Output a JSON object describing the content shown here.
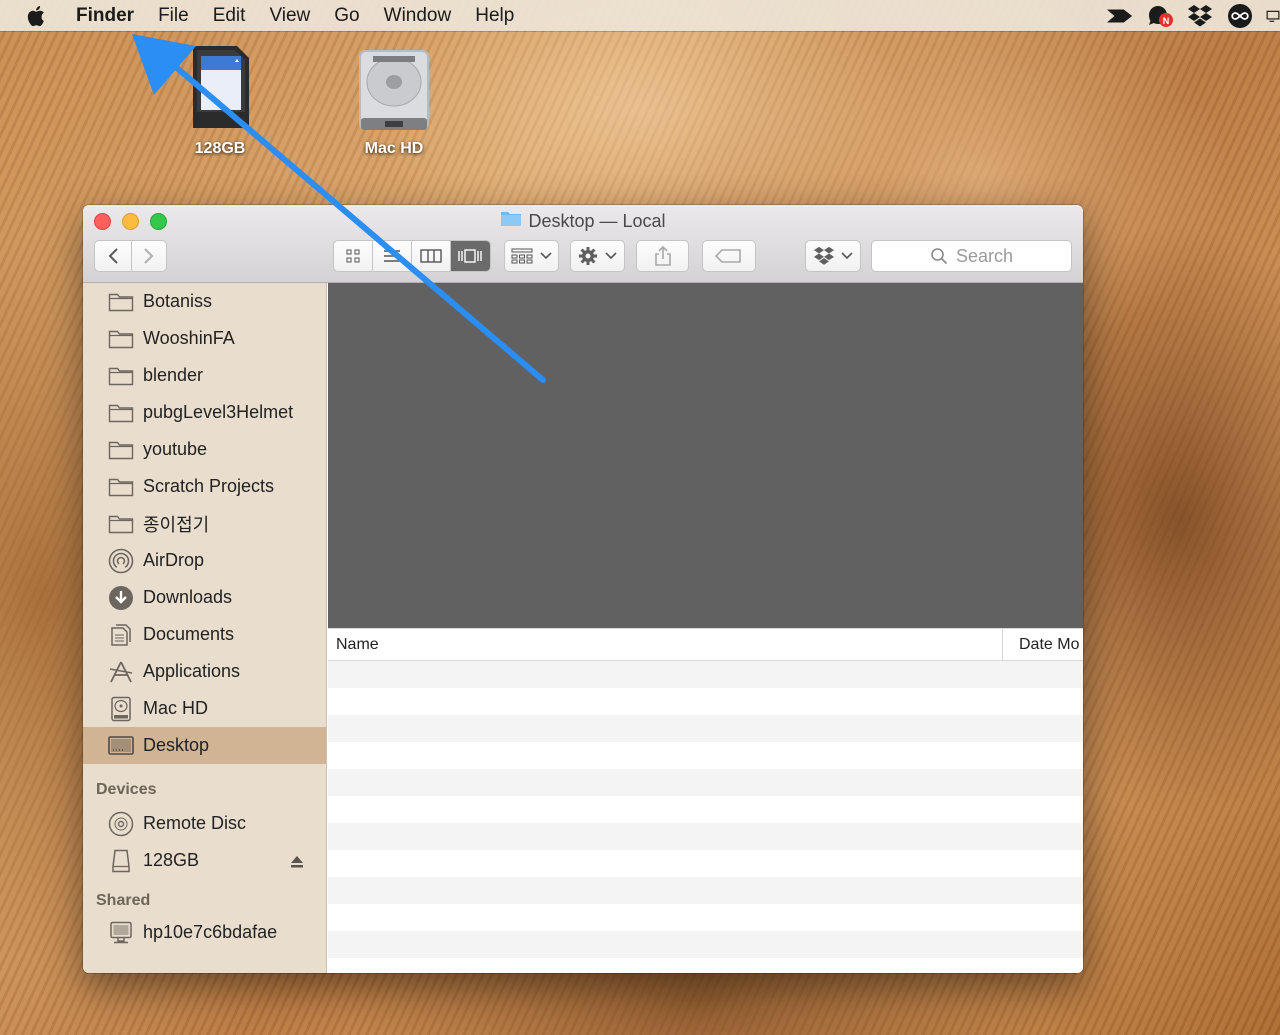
{
  "menubar": {
    "app_name": "Finder",
    "items": [
      "File",
      "Edit",
      "View",
      "Go",
      "Window",
      "Help"
    ],
    "status_icons": [
      "streak-icon",
      "notification-chat-icon",
      "dropbox-icon",
      "infinity-icon",
      "display-icon"
    ],
    "badge_letter": "N"
  },
  "desktop": {
    "icons": [
      {
        "label": "128GB",
        "icon": "sd-card-icon"
      },
      {
        "label": "Mac HD",
        "icon": "hard-drive-icon"
      }
    ]
  },
  "window": {
    "title": "Desktop — Local",
    "search_placeholder": "Search",
    "active_view": "cover-flow",
    "sidebar": {
      "favorites": [
        {
          "label": "Botaniss",
          "icon": "folder-icon"
        },
        {
          "label": "WooshinFA",
          "icon": "folder-icon"
        },
        {
          "label": "blender",
          "icon": "folder-icon"
        },
        {
          "label": "pubgLevel3Helmet",
          "icon": "folder-icon"
        },
        {
          "label": "youtube",
          "icon": "folder-icon"
        },
        {
          "label": "Scratch Projects",
          "icon": "folder-icon"
        },
        {
          "label": "종이접기",
          "icon": "folder-icon"
        },
        {
          "label": "AirDrop",
          "icon": "airdrop-icon"
        },
        {
          "label": "Downloads",
          "icon": "downloads-icon"
        },
        {
          "label": "Documents",
          "icon": "documents-icon"
        },
        {
          "label": "Applications",
          "icon": "applications-icon"
        },
        {
          "label": "Mac HD",
          "icon": "hard-drive-icon"
        },
        {
          "label": "Desktop",
          "icon": "desktop-icon",
          "selected": true
        }
      ],
      "devices_label": "Devices",
      "devices": [
        {
          "label": "Remote Disc",
          "icon": "disc-icon"
        },
        {
          "label": "128GB",
          "icon": "removable-drive-icon",
          "ejectable": true
        }
      ],
      "shared_label": "Shared",
      "shared": [
        {
          "label": "hp10e7c6bdafae",
          "icon": "network-computer-icon"
        }
      ]
    },
    "list": {
      "columns": [
        "Name",
        "Date Mo"
      ]
    }
  },
  "colors": {
    "selected_sidebar": "#d0b494",
    "preview_bg": "#616161",
    "arrow": "#2b8ef5"
  }
}
